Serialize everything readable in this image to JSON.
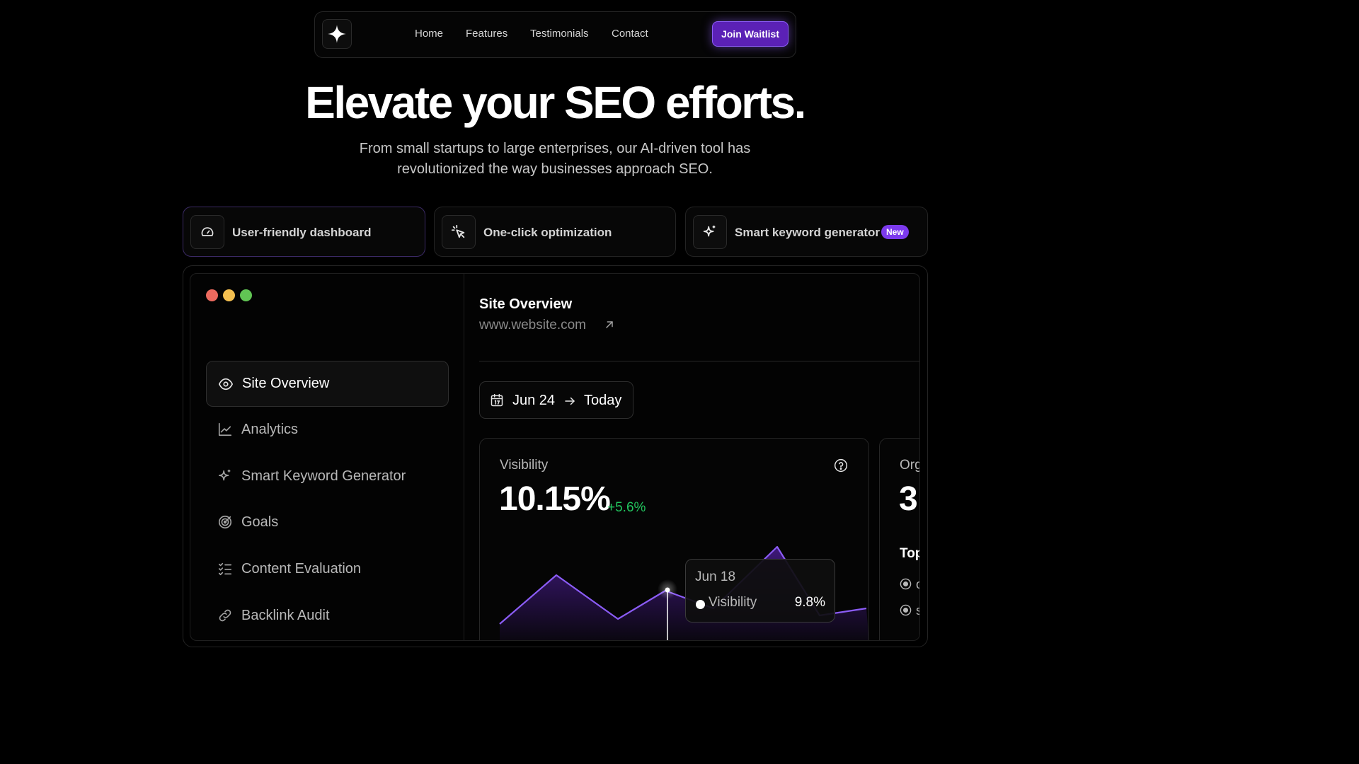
{
  "nav": {
    "links": [
      "Home",
      "Features",
      "Testimonials",
      "Contact"
    ],
    "cta": "Join Waitlist"
  },
  "hero": {
    "title": "Elevate your SEO efforts.",
    "subtitle_line1": "From small startups to large enterprises, our AI-driven tool has",
    "subtitle_line2": "revolutionized the way businesses approach SEO."
  },
  "features": [
    {
      "label": "User-friendly dashboard",
      "icon": "gauge-icon"
    },
    {
      "label": "One-click optimization",
      "icon": "cursor-click-icon"
    },
    {
      "label": "Smart keyword generator",
      "icon": "sparkle-icon",
      "badge": "New"
    }
  ],
  "window": {
    "traffic_lights": [
      "#ec6a5e",
      "#f4bf4f",
      "#61c554"
    ]
  },
  "sidebar": {
    "items": [
      {
        "label": "Site Overview",
        "icon": "eye-icon",
        "active": true
      },
      {
        "label": "Analytics",
        "icon": "line-chart-icon"
      },
      {
        "label": "Smart Keyword Generator",
        "icon": "sparkle-icon"
      },
      {
        "label": "Goals",
        "icon": "target-icon"
      },
      {
        "label": "Content Evaluation",
        "icon": "checklist-icon"
      },
      {
        "label": "Backlink Audit",
        "icon": "link-icon"
      }
    ]
  },
  "main": {
    "title": "Site Overview",
    "url": "www.website.com",
    "date_from": "Jun 24",
    "date_to": "Today"
  },
  "visibility": {
    "label": "Visibility",
    "value": "10.15%",
    "delta": "+5.6%",
    "tooltip": {
      "date": "Jun 18",
      "series": "Visibility",
      "value": "9.8%"
    }
  },
  "organic": {
    "label": "Org",
    "value": "3",
    "top_label": "Top",
    "rows": [
      "o",
      "s"
    ]
  },
  "colors": {
    "accent": "#7c3aed",
    "accent_light": "#8b5cf6",
    "positive": "#22c55e"
  }
}
